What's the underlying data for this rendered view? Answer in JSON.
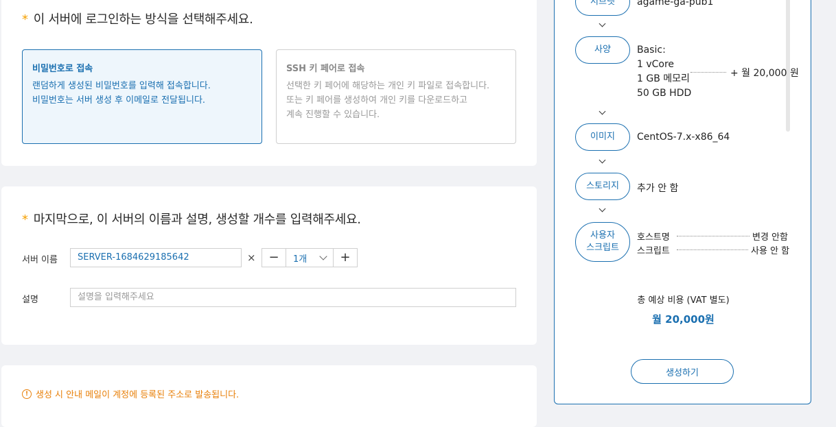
{
  "login_section": {
    "required_mark": "*",
    "question": "이 서버에 로그인하는 방식을 선택해주세요.",
    "options": [
      {
        "title": "비밀번호로 접속",
        "lines": [
          "랜덤하게 생성된 비밀번호를 입력해 접속합니다.",
          "비밀번호는 서버 생성 후 이메일로 전달됩니다."
        ],
        "selected": true
      },
      {
        "title": "SSH 키 페어로 접속",
        "lines": [
          "선택한 키 페어에 해당하는 개인 키 파일로 접속합니다.",
          "또는 키 페어를 생성하여 개인 키를 다운로드하고",
          "계속 진행할 수 있습니다."
        ],
        "selected": false
      }
    ]
  },
  "name_section": {
    "required_mark": "*",
    "question": "마지막으로, 이 서버의 이름과 설명, 생성할 개수를 입력해주세요.",
    "server_name_label": "서버 이름",
    "server_name_value": "SERVER-1684629185642",
    "times_symbol": "×",
    "count_value": "1개",
    "minus": "−",
    "plus": "+",
    "description_label": "설명",
    "description_placeholder": "설명을 입력해주세요"
  },
  "notice": {
    "icon": "!",
    "text": "생성 시 안내 메일이 계정에 등록된 주소로 발송됩니다."
  },
  "summary": {
    "zone": {
      "label": "서브넷",
      "value": "agame-ga-pub1"
    },
    "spec": {
      "label": "사양",
      "lines": [
        "Basic:",
        "1 vCore",
        "1 GB 메모리",
        "50 GB HDD"
      ],
      "price": "+ 월 20,000 원"
    },
    "image": {
      "label": "이미지",
      "value": "CentOS-7.x-x86_64"
    },
    "storage": {
      "label": "스토리지",
      "value": "추가 안 함"
    },
    "user_script": {
      "label_line1": "사용자",
      "label_line2": "스크립트",
      "rows": [
        {
          "key": "호스트명",
          "value": "변경 안함"
        },
        {
          "key": "스크립트",
          "value": "사용 안 함"
        }
      ]
    },
    "total_label": "총 예상 비용 (VAT 별도)",
    "total_value": "월 20,000원",
    "create_button": "생성하기"
  },
  "colors": {
    "accent": "#1a6fb0",
    "warning": "#e8800a",
    "star": "#f5a000",
    "background": "#f1f2f5"
  }
}
